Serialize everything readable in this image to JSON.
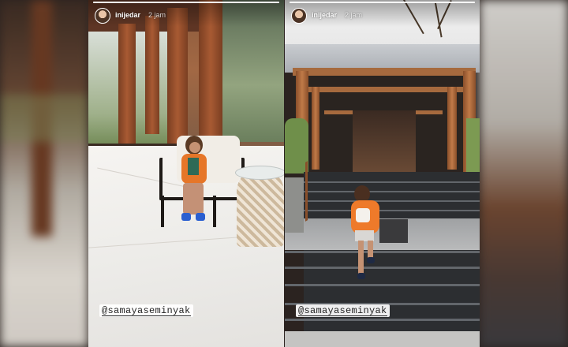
{
  "stories": [
    {
      "username": "inijedar",
      "timestamp": "2 jam",
      "mention": "@samayaseminyak",
      "progress": 1.0
    },
    {
      "username": "inijedar",
      "timestamp": "2 jam",
      "mention": "@samayaseminyak",
      "progress": 1.0
    }
  ],
  "icons": [
    "avatar"
  ],
  "colors": {
    "wood": "#a66a3e",
    "kid_jacket": "#ee7a2a",
    "mention_bg": "#ffffff"
  }
}
